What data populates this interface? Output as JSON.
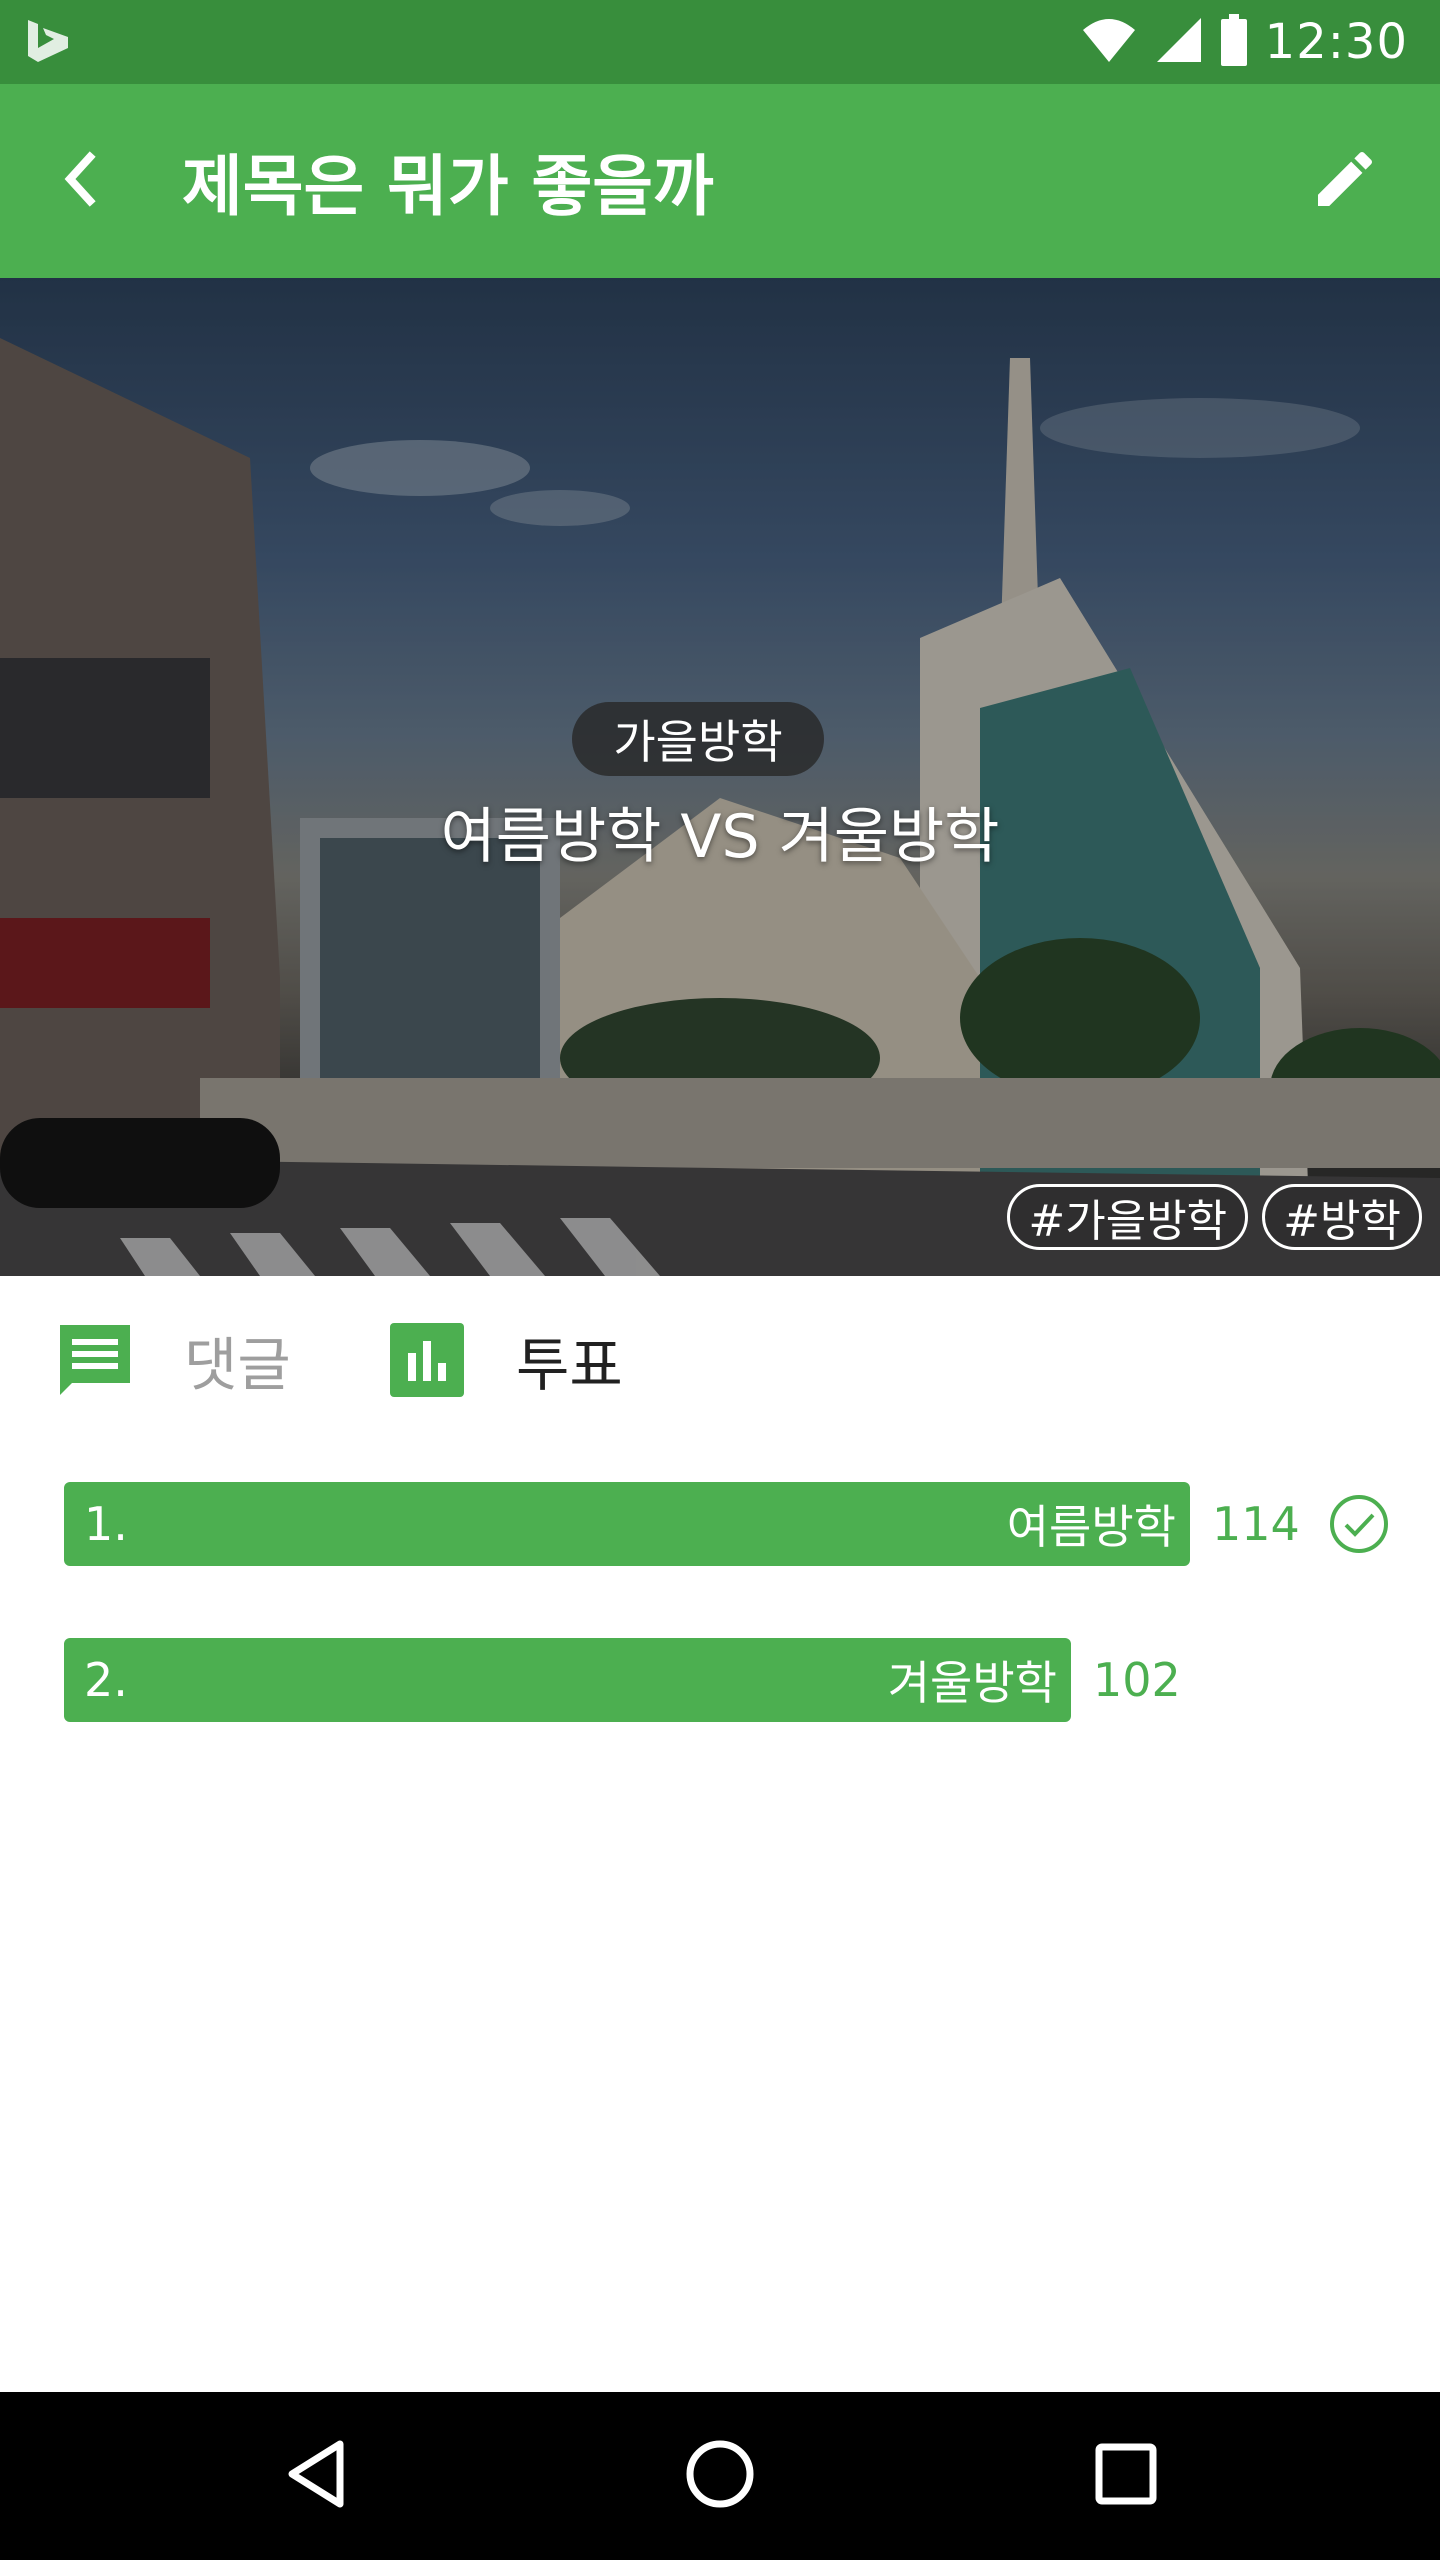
{
  "status_bar": {
    "time": "12:30",
    "app_icon": "bing-icon",
    "icons": [
      "wifi-icon",
      "signal-icon",
      "battery-icon"
    ]
  },
  "app_bar": {
    "title": "제목은 뭐가 좋을까",
    "back_icon": "chevron-left-icon",
    "edit_icon": "pencil-icon"
  },
  "hero": {
    "category": "가을방학",
    "headline": "여름방학 VS 겨울방학",
    "tags": [
      "#가을방학",
      "#방학"
    ]
  },
  "tabs": {
    "comment_label": "댓글",
    "vote_label": "투표",
    "comment_icon": "comment-icon",
    "vote_icon": "bar-chart-icon"
  },
  "votes": [
    {
      "index": "1.",
      "label": "여름방학",
      "count": "114",
      "value": 114,
      "selected": true
    },
    {
      "index": "2.",
      "label": "겨울방학",
      "count": "102",
      "value": 102,
      "selected": false
    }
  ],
  "nav_bar": {
    "icons": [
      "back-triangle-icon",
      "home-circle-icon",
      "recents-square-icon"
    ]
  },
  "colors": {
    "status_bar": "#388e3c",
    "app_bar": "#4caf50",
    "accent": "#4caf50",
    "inactive_text": "#9e9e9e"
  }
}
